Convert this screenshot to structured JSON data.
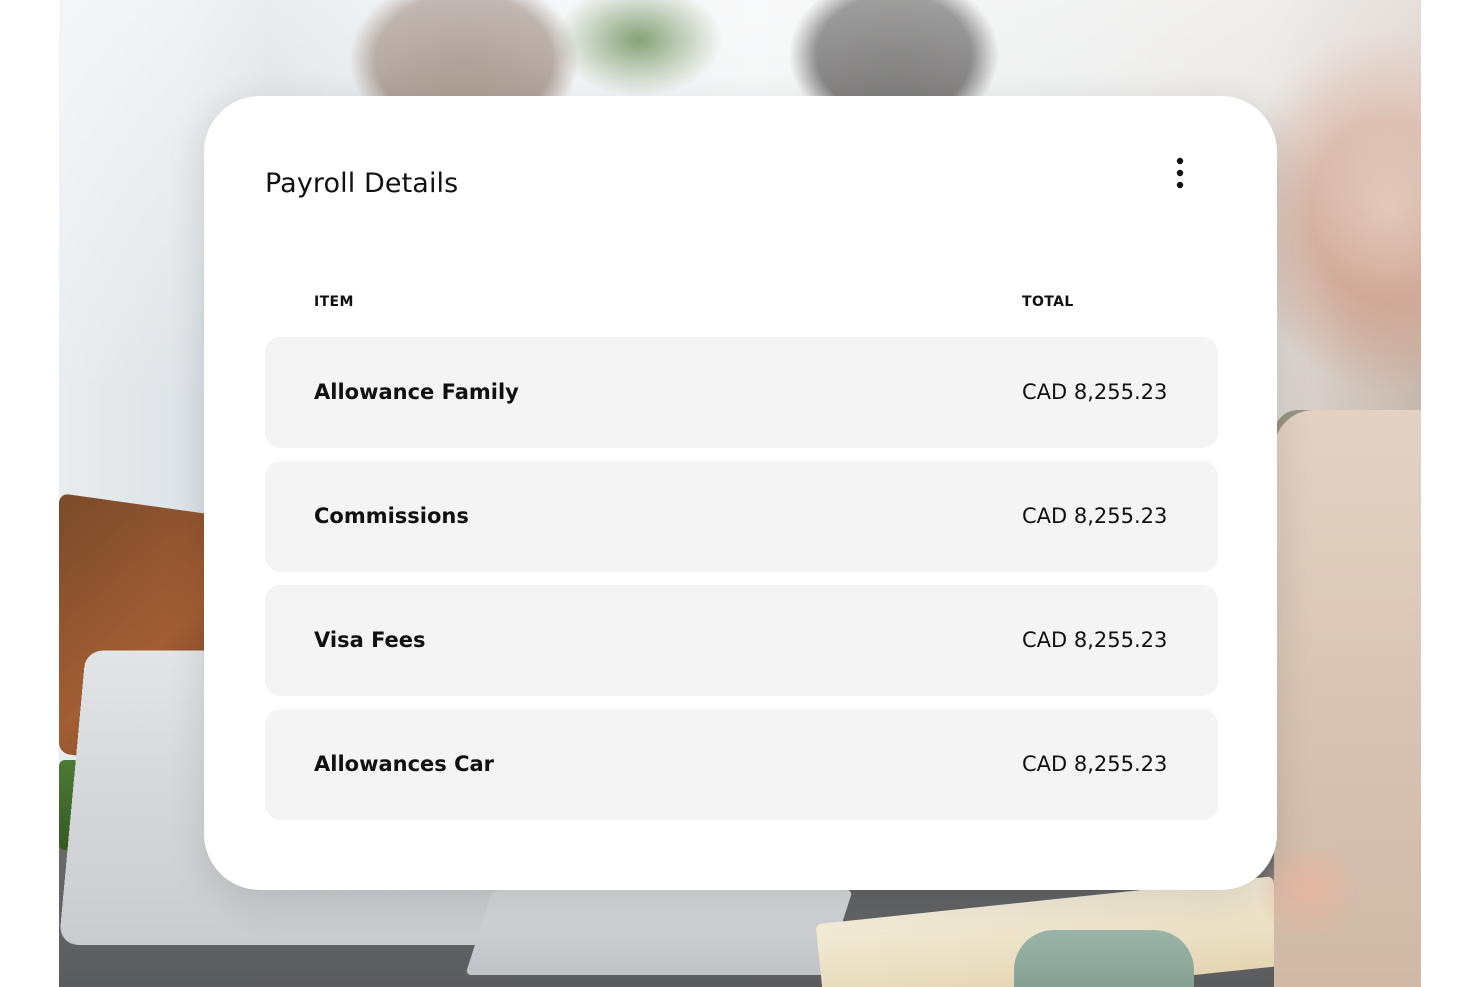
{
  "background": {
    "icon": "office-meeting-photo"
  },
  "card": {
    "title": "Payroll Details",
    "menu_icon": "more-vertical-icon",
    "columns": {
      "item": "ITEM",
      "total": "TOTAL"
    },
    "rows": [
      {
        "item": "Allowance Family",
        "total": "CAD 8,255.23"
      },
      {
        "item": "Commissions",
        "total": "CAD 8,255.23"
      },
      {
        "item": "Visa Fees",
        "total": "CAD 8,255.23"
      },
      {
        "item": "Allowances Car",
        "total": "CAD 8,255.23"
      }
    ]
  },
  "colors": {
    "card_background": "#ffffff",
    "row_background": "#f4f4f4",
    "text": "#111111"
  }
}
